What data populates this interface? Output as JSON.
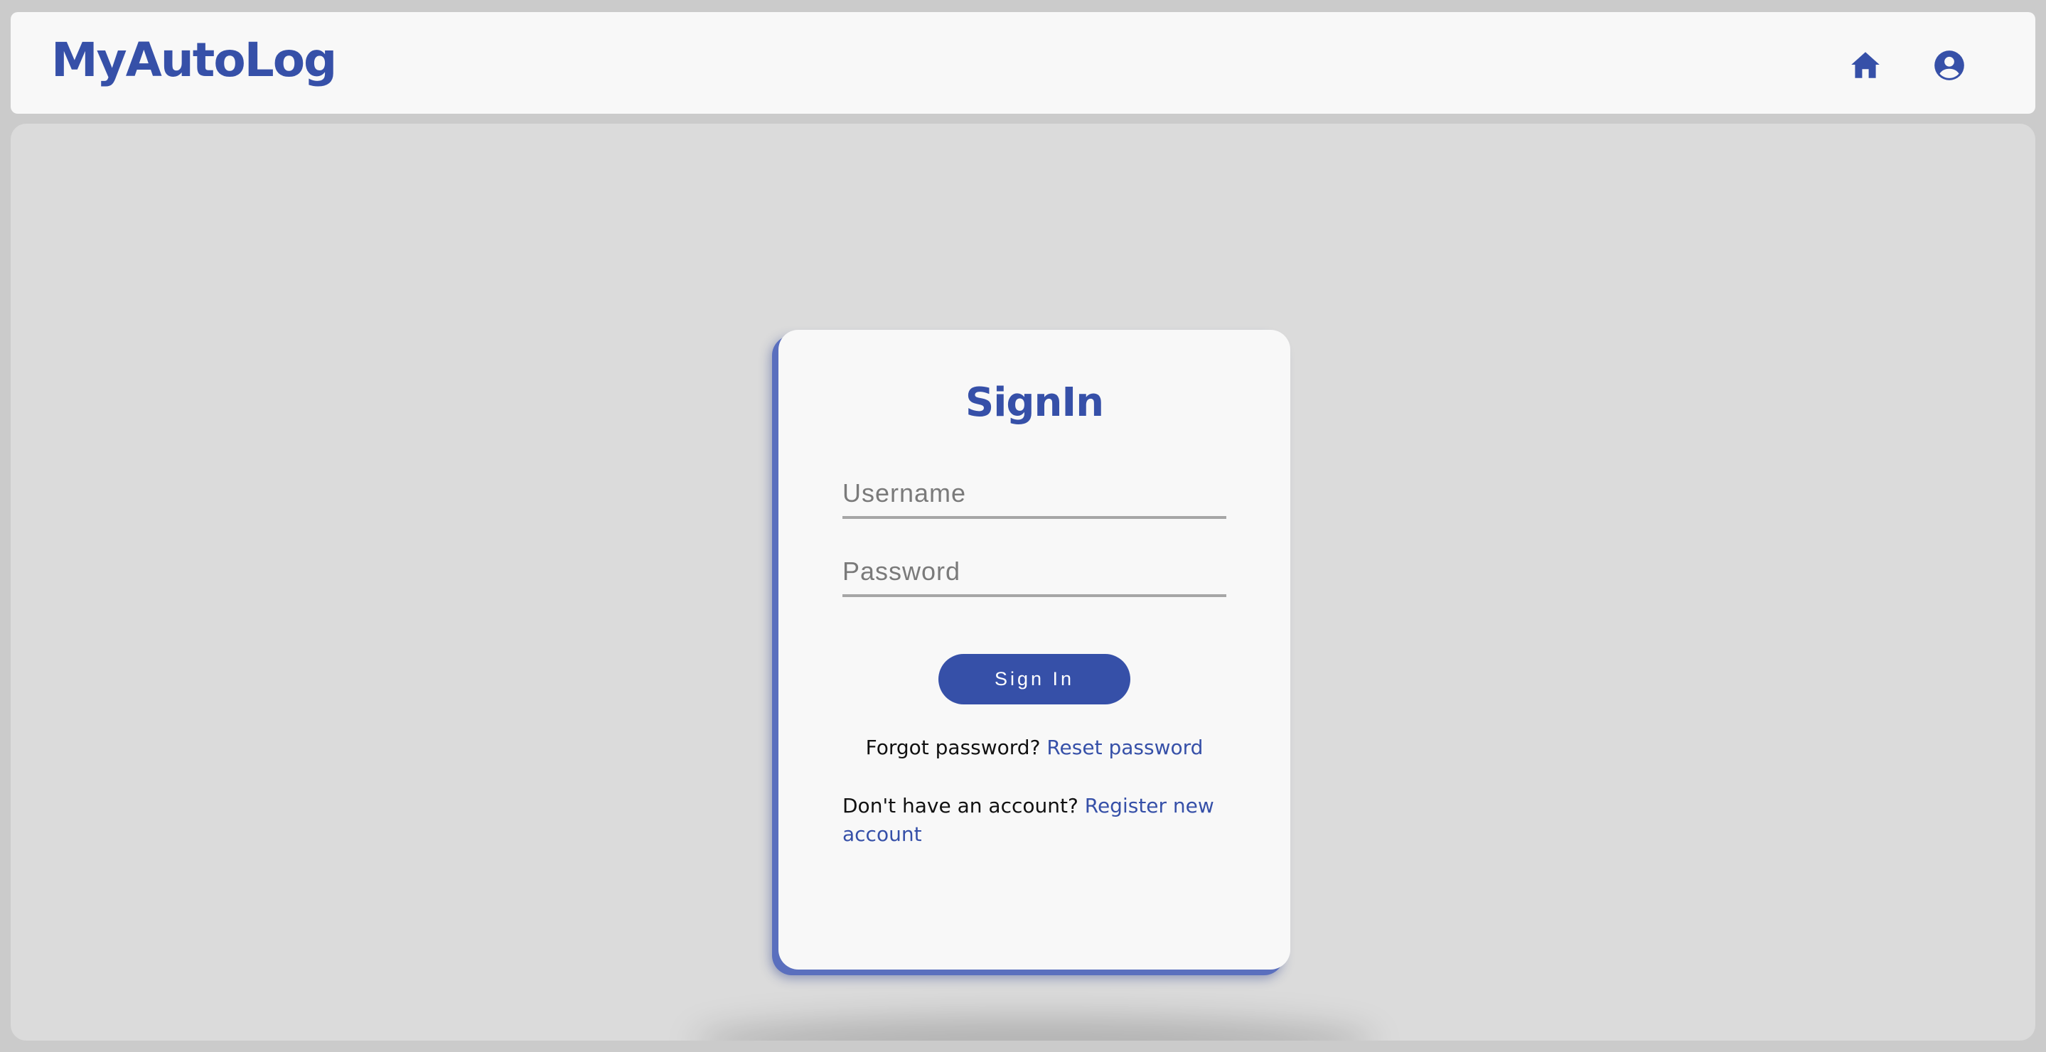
{
  "header": {
    "brand": "MyAutoLog",
    "icons": [
      "home-icon",
      "account-circle-icon"
    ]
  },
  "signin": {
    "title": "SignIn",
    "username_placeholder": "Username",
    "password_placeholder": "Password",
    "button_label": "Sign In",
    "forgot_text": "Forgot password?",
    "reset_link": "Reset password",
    "register_text": "Don't have an account?",
    "register_link": "Register new account"
  },
  "colors": {
    "accent": "#3650a8",
    "page_background": "#dbdbdb",
    "card_background": "#f8f8f8"
  }
}
